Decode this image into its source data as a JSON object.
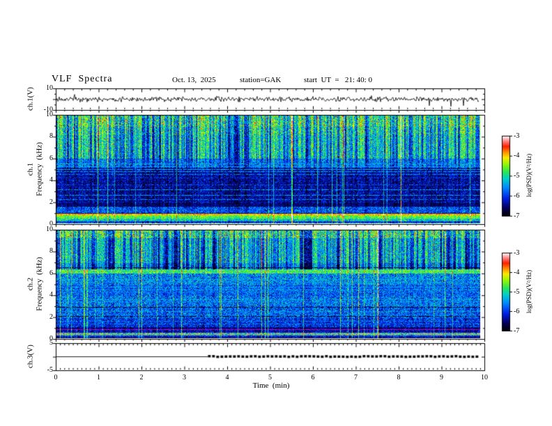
{
  "figure": {
    "title": "VLF  Spectra",
    "date": "Oct. 13,  2025",
    "station": "station=GAK",
    "start_ut": "start  UT  =   21: 40: 0"
  },
  "axes": {
    "time_label": "Time  (min)",
    "x_ticks": [
      "0",
      "1",
      "2",
      "3",
      "4",
      "5",
      "6",
      "7",
      "8",
      "9",
      "10"
    ],
    "ch1_wave": {
      "label": "ch.1(V)",
      "ticks": [
        "10",
        "-10"
      ]
    },
    "ch1_spec": {
      "label_line1": "ch.1",
      "label_line2": "Frequency  (kHz)",
      "ticks": [
        "10",
        "8",
        "6",
        "4",
        "2",
        "0"
      ]
    },
    "ch2_spec": {
      "label_line1": "ch.2",
      "label_line2": "Frequency  (kHz)",
      "ticks": [
        "10",
        "8",
        "6",
        "4",
        "2",
        "0"
      ]
    },
    "ch3": {
      "label": "ch.3(V)",
      "ticks": [
        "5",
        "-5"
      ]
    }
  },
  "colorbars": [
    {
      "label": "log(PSD)(V²/Hz)",
      "ticks": [
        "-3",
        "-4",
        "-5",
        "-6",
        "-7"
      ]
    },
    {
      "label": "log(PSD)(V²/Hz)",
      "ticks": [
        "-3",
        "-4",
        "-5",
        "-6",
        "-7"
      ]
    }
  ],
  "colors": {
    "background": "#ffffff",
    "frame": "#000000",
    "trace": "#000000",
    "purple_line": [
      170,
      0,
      200
    ],
    "colormap_stops": [
      [
        0.0,
        0,
        0,
        0
      ],
      [
        0.1,
        5,
        0,
        90
      ],
      [
        0.22,
        0,
        30,
        230
      ],
      [
        0.36,
        0,
        140,
        255
      ],
      [
        0.47,
        0,
        210,
        200
      ],
      [
        0.55,
        40,
        230,
        90
      ],
      [
        0.65,
        150,
        250,
        0
      ],
      [
        0.73,
        250,
        235,
        0
      ],
      [
        0.8,
        255,
        140,
        0
      ],
      [
        0.87,
        255,
        30,
        0
      ],
      [
        0.93,
        255,
        120,
        120
      ],
      [
        1.0,
        255,
        255,
        255
      ]
    ]
  },
  "chart_data": {
    "type": "heatmap",
    "title": "VLF Spectra",
    "subtitle": "Oct. 13, 2025  station=GAK  start UT = 21:40:0",
    "x": {
      "label": "Time (min)",
      "range": [
        0,
        10
      ],
      "ticks": [
        0,
        1,
        2,
        3,
        4,
        5,
        6,
        7,
        8,
        9,
        10
      ],
      "minor_per_major": 10,
      "data_end_min": 9.88
    },
    "colorbar": {
      "label": "log(PSD)(V²/Hz)",
      "range": [
        -7,
        -3
      ],
      "ticks": [
        -3,
        -4,
        -5,
        -6,
        -7
      ],
      "colormap": "black-blue-cyan-green-yellow-red-white rainbow"
    },
    "panels": [
      {
        "name": "ch1_waveform",
        "type": "line",
        "ylabel": "ch.1(V)",
        "yrange": [
          -10,
          10
        ],
        "description": "continuous broadband noise trace centred on 0 V, typical amplitude ±2 V, sparse negative spikes to -8 V",
        "noise_sd_v": 1.15,
        "neg_spike_prob": 0.005,
        "neg_spike_v": [
          -3,
          -8
        ],
        "pos_spike_prob": 0.003,
        "pos_spike_v": [
          2,
          4
        ]
      },
      {
        "name": "ch1_spectrogram",
        "type": "heatmap",
        "ylabel": "ch.1 Frequency (kHz)",
        "yrange": [
          0,
          10
        ],
        "zrange": [
          -7,
          -3
        ],
        "bands": [
          [
            9.0,
            10.0,
            -6.15,
            0.45
          ],
          [
            8.2,
            9.0,
            -6.35,
            0.4
          ],
          [
            6.0,
            8.2,
            -6.5,
            0.35
          ],
          [
            5.2,
            6.0,
            -6.35,
            0.35
          ],
          [
            4.4,
            5.2,
            -6.6,
            0.3
          ],
          [
            1.9,
            4.4,
            -6.65,
            0.3
          ],
          [
            1.55,
            1.9,
            -6.85,
            0.2
          ],
          [
            1.0,
            1.55,
            -6.1,
            0.35
          ],
          [
            0.95,
            1.0,
            -6.6,
            0.2
          ],
          [
            0.82,
            0.95,
            -4.2,
            0.3
          ],
          [
            0.72,
            0.82,
            -4.55,
            0.25
          ],
          [
            0.58,
            0.72,
            -4.85,
            0.25
          ],
          [
            0.42,
            0.58,
            -5.1,
            0.3
          ],
          [
            0.25,
            0.42,
            -5.45,
            0.4
          ],
          [
            0.1,
            0.25,
            -6.4,
            0.3
          ],
          [
            0.0,
            0.1,
            -5.7,
            0.5
          ]
        ],
        "hlines": [
          [
            5.55,
            -5.35,
            0.85
          ],
          [
            5.3,
            -5.45,
            0.8
          ],
          [
            5.05,
            -5.3,
            0.85
          ],
          [
            4.85,
            -5.4,
            0.8
          ],
          [
            4.6,
            -5.5,
            0.7
          ],
          [
            4.25,
            -5.9,
            0.6
          ],
          [
            3.6,
            -5.8,
            0.6
          ],
          [
            3.15,
            -5.4,
            0.8
          ],
          [
            2.65,
            -5.45,
            0.8
          ],
          [
            2.25,
            -5.55,
            0.7
          ],
          [
            1.75,
            -6.3,
            0.5
          ],
          [
            0.88,
            -3.9,
            0.55
          ]
        ],
        "streaks": {
          "corr": 0.38,
          "thresh": 0.4,
          "strongF": 6.0,
          "strongAmp": 2.1,
          "midF": 5.2,
          "midAmp": 1.1,
          "lowAmp": 0.45,
          "thinProb": 0.035,
          "thinBoost": 0.95
        }
      },
      {
        "name": "ch2_spectrogram",
        "type": "heatmap",
        "ylabel": "ch.2 Frequency (kHz)",
        "yrange": [
          0,
          10
        ],
        "zrange": [
          -7,
          -3
        ],
        "bands": [
          [
            9.3,
            10.0,
            -6.05,
            0.5
          ],
          [
            7.0,
            9.3,
            -6.5,
            0.35
          ],
          [
            6.45,
            7.0,
            -6.8,
            0.3
          ],
          [
            6.05,
            6.45,
            -4.9,
            0.35
          ],
          [
            5.0,
            6.05,
            -5.75,
            0.4
          ],
          [
            4.0,
            5.0,
            -5.95,
            0.35
          ],
          [
            3.0,
            4.0,
            -5.85,
            0.4
          ],
          [
            1.9,
            3.0,
            -5.95,
            0.4
          ],
          [
            1.05,
            1.9,
            -6.2,
            0.35
          ],
          [
            0.9,
            1.05,
            -6.65,
            0.25
          ],
          [
            0.78,
            0.9,
            -5.0,
            0.3,
            "purple"
          ],
          [
            0.58,
            0.78,
            -6.5,
            0.3
          ],
          [
            0.3,
            0.58,
            -5.35,
            0.45,
            "gray"
          ],
          [
            0.12,
            0.3,
            -6.35,
            0.3
          ],
          [
            0.0,
            0.12,
            -6.9,
            0.15
          ]
        ],
        "hlines": [
          [
            5.5,
            -5.35,
            0.7
          ],
          [
            5.2,
            -5.45,
            0.65
          ],
          [
            4.75,
            -5.4,
            0.7
          ],
          [
            4.5,
            -5.35,
            0.7
          ],
          [
            4.3,
            -5.5,
            0.6
          ],
          [
            3.6,
            -5.3,
            0.7
          ],
          [
            3.4,
            -5.45,
            0.65
          ],
          [
            2.5,
            -5.4,
            0.7
          ],
          [
            2.2,
            -5.5,
            0.6
          ],
          [
            1.6,
            -5.6,
            0.6
          ],
          [
            1.35,
            -5.7,
            0.55
          ],
          [
            2.9,
            -6.9,
            0.7
          ],
          [
            2.05,
            -6.9,
            0.6
          ],
          [
            6.6,
            -6.95,
            0.8
          ]
        ],
        "streaks": {
          "corr": 0.38,
          "thresh": 0.48,
          "strongF": 6.45,
          "strongAmp": 1.9,
          "midF": 6.05,
          "midAmp": 0.25,
          "lowAmp": 0.3,
          "thinProb": 0.04,
          "thinBoost": 0.9
        }
      },
      {
        "name": "ch3_waveform",
        "type": "line",
        "ylabel": "ch.3(V)",
        "yrange": [
          -5,
          5
        ],
        "description": "flat 0 V line; thin until 3.55 min, then thick dashed until 9.85 min",
        "flat_end_min": 3.55,
        "dash_end_min": 9.85,
        "value_v": 0
      }
    ]
  }
}
